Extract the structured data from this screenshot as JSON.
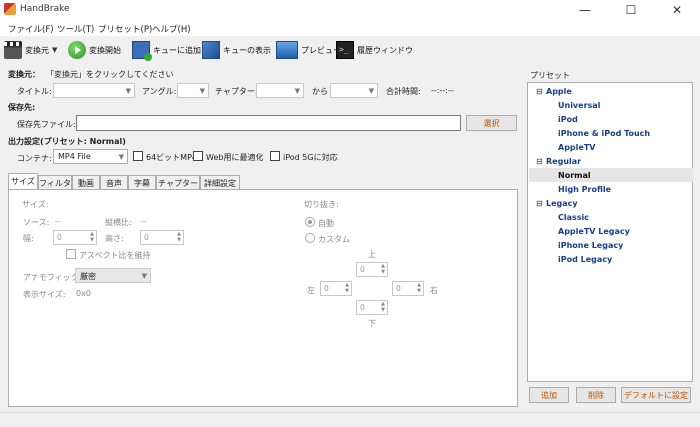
{
  "window": {
    "title": "HandBrake",
    "controls": [
      "—",
      "☐",
      "✕"
    ]
  },
  "menu": [
    "ファイル(F)",
    "ツール(T)",
    "プリセット(P)",
    "ヘルプ(H)"
  ],
  "toolbar": {
    "source": "変換元",
    "start": "変換開始",
    "add_queue": "キューに追加",
    "show_queue": "キューの表示",
    "preview": "プレビュー",
    "activity": "履歴ウィンドウ"
  },
  "source": {
    "heading": "変換元：",
    "hint": "「変換元」をクリックしてください",
    "title_label": "タイトル:",
    "angle_label": "アングル:",
    "chapter_label": "チャプター:",
    "from": "から",
    "duration_label": "合計時間:",
    "duration_value": "--:--:--"
  },
  "destination": {
    "heading": "保存先:",
    "file_label": "保存先ファイル:",
    "file_value": "",
    "browse": "選択"
  },
  "output": {
    "heading": "出力設定(プリセット: Normal)",
    "container_label": "コンテナ:",
    "container_value": "MP4 File",
    "opt_64bit": "64ビットMP4",
    "opt_web": "Web用に最適化",
    "opt_ipod": "iPod 5Gに対応"
  },
  "tabs": [
    "サイズ",
    "フィルタ",
    "動画",
    "音声",
    "字幕",
    "チャプター",
    "詳細設定"
  ],
  "size": {
    "heading": "サイズ:",
    "source_label": "ソース:",
    "source_value": "--",
    "aspect_label": "縦横比:",
    "aspect_value": "--",
    "width_label": "幅:",
    "width_value": "0",
    "height_label": "高さ:",
    "height_value": "0",
    "keep_aspect": "アスペクト比を維持",
    "anamorphic_label": "アナモフィック:",
    "anamorphic_value": "厳密",
    "display_label": "表示サイズ:",
    "display_value": "0x0"
  },
  "crop": {
    "heading": "切り抜き:",
    "auto": "自動",
    "custom": "カスタム",
    "top": "上",
    "bottom": "下",
    "left": "左",
    "right": "右",
    "top_value": "0",
    "bottom_value": "0",
    "left_value": "0",
    "right_value": "0"
  },
  "presets": {
    "label": "プリセット",
    "groups": [
      {
        "name": "Apple",
        "items": [
          "Universal",
          "iPod",
          "iPhone & iPod Touch",
          "AppleTV"
        ]
      },
      {
        "name": "Regular",
        "items": [
          "Normal",
          "High Profile"
        ]
      },
      {
        "name": "Legacy",
        "items": [
          "Classic",
          "AppleTV Legacy",
          "iPhone Legacy",
          "iPod Legacy"
        ]
      }
    ],
    "selected": "Normal",
    "add": "追加",
    "remove": "削除",
    "set_default": "デフォルトに設定"
  }
}
